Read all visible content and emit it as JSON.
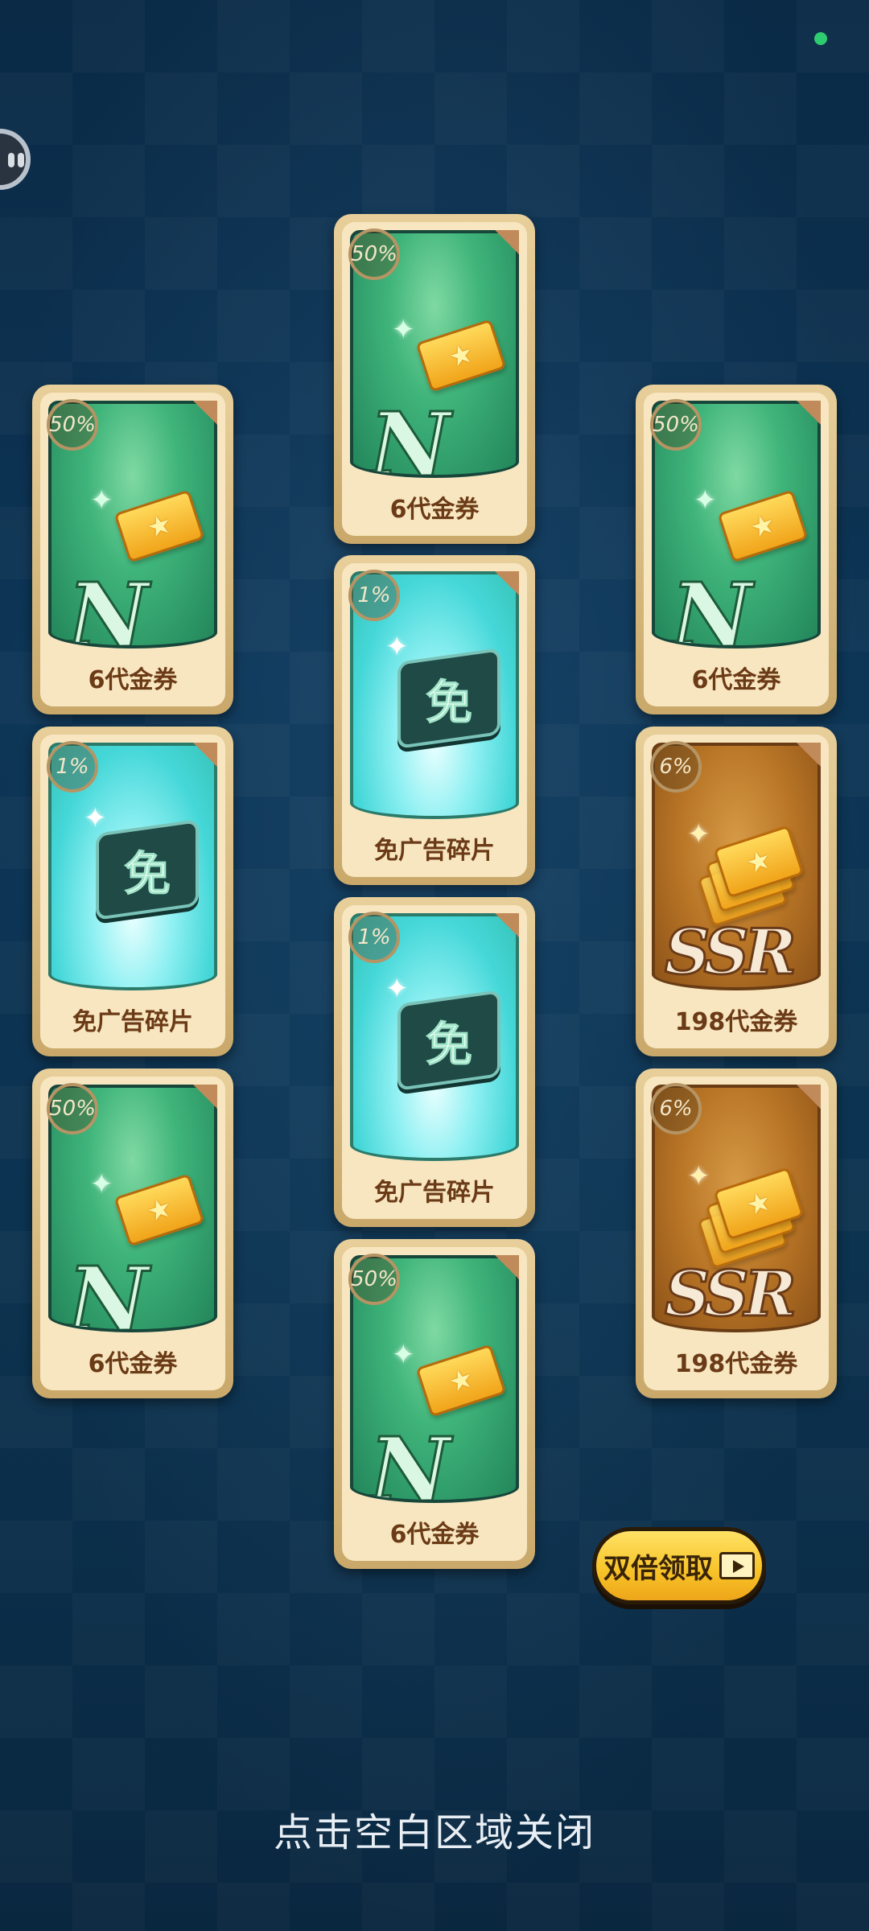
{
  "status_dot_color": "#2ecc71",
  "cards": [
    {
      "pct": "50%",
      "label": "6代金券",
      "rarity": "N",
      "type": "green",
      "item": "gold-ticket"
    },
    {
      "pct": "50%",
      "label": "6代金券",
      "rarity": "N",
      "type": "green",
      "item": "gold-ticket"
    },
    {
      "pct": "50%",
      "label": "6代金券",
      "rarity": "N",
      "type": "green",
      "item": "gold-ticket"
    },
    {
      "pct": "1%",
      "label": "免广告碎片",
      "icon_char": "免",
      "type": "cyan",
      "item": "puzzle-piece"
    },
    {
      "pct": "1%",
      "label": "免广告碎片",
      "icon_char": "免",
      "type": "cyan",
      "item": "puzzle-piece"
    },
    {
      "pct": "6%",
      "label": "198代金券",
      "rarity": "SSR",
      "type": "gold",
      "item": "ticket-stack"
    },
    {
      "pct": "1%",
      "label": "免广告碎片",
      "icon_char": "免",
      "type": "cyan",
      "item": "puzzle-piece"
    },
    {
      "pct": "50%",
      "label": "6代金券",
      "rarity": "N",
      "type": "green",
      "item": "gold-ticket"
    },
    {
      "pct": "6%",
      "label": "198代金券",
      "rarity": "SSR",
      "type": "gold",
      "item": "ticket-stack"
    },
    {
      "pct": "50%",
      "label": "6代金券",
      "rarity": "N",
      "type": "green",
      "item": "gold-ticket"
    }
  ],
  "double_claim_button": {
    "label": "双倍领取",
    "icon": "video-icon"
  },
  "close_hint": "点击空白区域关闭"
}
